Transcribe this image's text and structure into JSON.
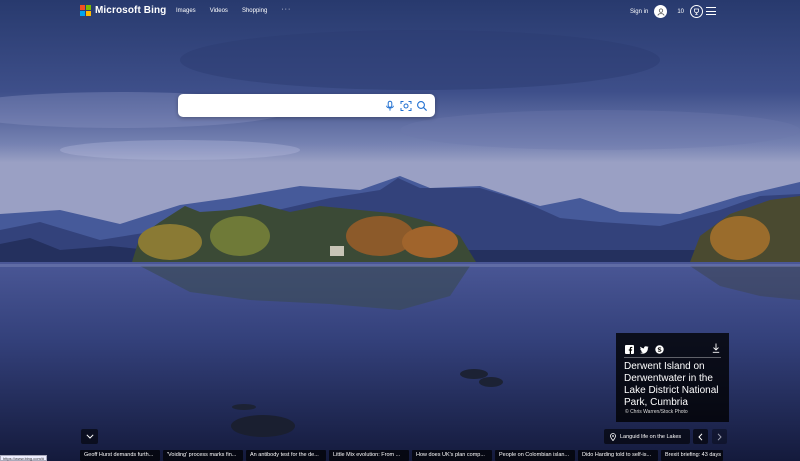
{
  "header": {
    "brand": "Microsoft Bing",
    "nav": [
      "Images",
      "Videos",
      "Shopping"
    ],
    "more": "···",
    "sign_in": "Sign in",
    "rewards": "10"
  },
  "search": {
    "value": "",
    "placeholder": ""
  },
  "image_card": {
    "title": "Derwent Island on Derwentwater in the Lake District National Park, Cumbria",
    "credit": "© Chris Warren/Stock Photo"
  },
  "location": {
    "label": "Languid life on the Lakes"
  },
  "news": [
    "Geoff Hurst demands furth...",
    "'Voiding' process marks fin...",
    "An antibody test for the de...",
    "Little Mix evolution: From ...",
    "How does UK's plan comp...",
    "People on Colombian islan...",
    "Dido Harding told to self-is...",
    "Brexit briefing: 43 days"
  ],
  "status_url": "https://www.bing.com/#"
}
